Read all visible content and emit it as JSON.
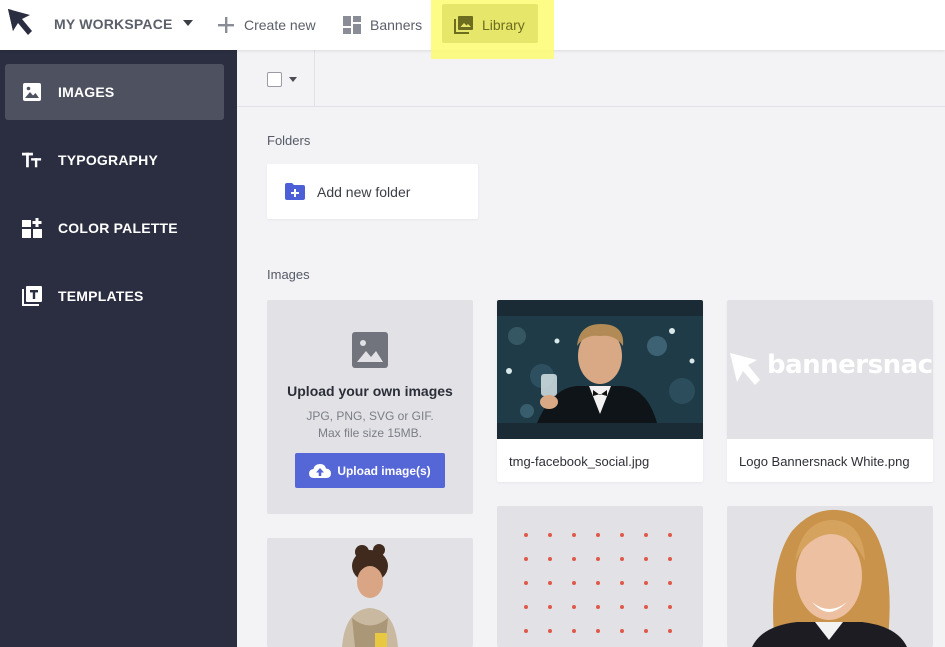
{
  "header": {
    "workspace_label": "MY WORKSPACE",
    "nav": {
      "create_new": "Create new",
      "banners": "Banners",
      "library": "Library"
    },
    "highlight_color": "#fbfb6b"
  },
  "sidebar": {
    "items": [
      {
        "label": "IMAGES",
        "icon": "image-icon",
        "active": true
      },
      {
        "label": "TYPOGRAPHY",
        "icon": "typography-icon",
        "active": false
      },
      {
        "label": "COLOR PALETTE",
        "icon": "color-palette-icon",
        "active": false
      },
      {
        "label": "TEMPLATES",
        "icon": "templates-icon",
        "active": false
      }
    ]
  },
  "main": {
    "folders_heading": "Folders",
    "add_folder_label": "Add new folder",
    "images_heading": "Images",
    "upload": {
      "title": "Upload your own images",
      "formats": "JPG, PNG, SVG or GIF.",
      "max_size": "Max file size 15MB.",
      "button_label": "Upload image(s)"
    },
    "image_cards": [
      {
        "caption": "tmg-facebook_social.jpg",
        "thumb": "man-raising-glass-photo"
      },
      {
        "caption": "Logo Bannersnack White.png",
        "thumb": "bannersnack-logo",
        "logo_text": "bannersnack"
      }
    ],
    "partial_cards": [
      {
        "thumb": "woman-with-scarf-photo"
      },
      {
        "thumb": "red-dot-pattern"
      },
      {
        "thumb": "blonde-woman-portrait"
      }
    ]
  },
  "colors": {
    "sidebar_bg": "#2b2e40",
    "accent": "#5566d6",
    "folder_icon": "#4c5fd6"
  }
}
